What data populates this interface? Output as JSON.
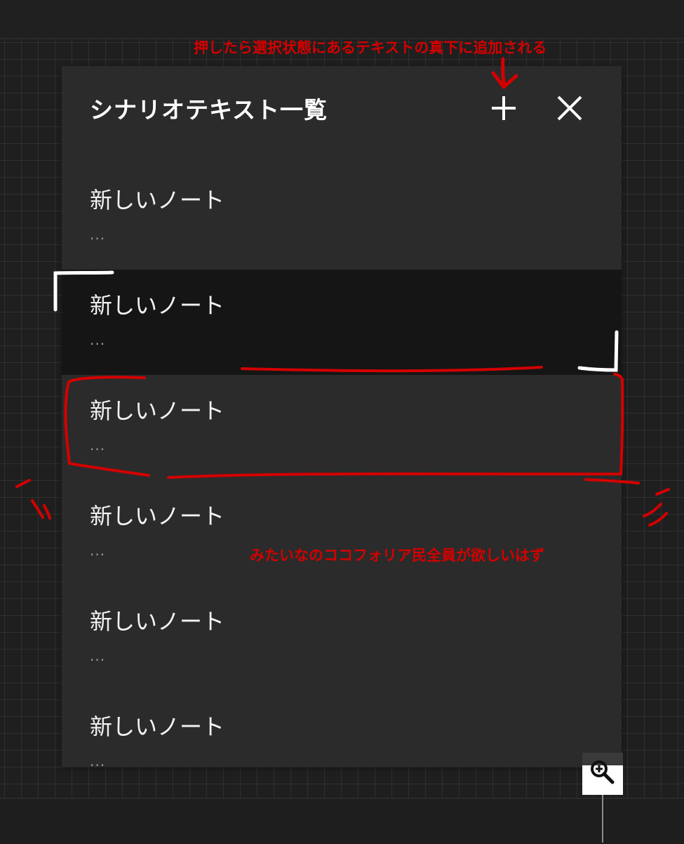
{
  "panel": {
    "title": "シナリオテキスト一覧",
    "add_icon": "plus-icon",
    "close_icon": "close-icon"
  },
  "notes": [
    {
      "title": "新しいノート",
      "preview": "...",
      "selected": false
    },
    {
      "title": "新しいノート",
      "preview": "...",
      "selected": true
    },
    {
      "title": "新しいノート",
      "preview": "...",
      "selected": false
    },
    {
      "title": "新しいノート",
      "preview": "...",
      "selected": false
    },
    {
      "title": "新しいノート",
      "preview": "...",
      "selected": false
    },
    {
      "title": "新しいノート",
      "preview": "...",
      "selected": false
    }
  ],
  "annotations": {
    "top_note": "押したら選択状態にあるテキストの真下に追加される",
    "middle_note": "みたいなのココフォリア民全員が欲しいはず"
  },
  "zoom": {
    "icon": "zoom-in-icon"
  },
  "colors": {
    "panel_bg": "#2b2b2b",
    "selected_bg": "#151515",
    "annotation_red": "#d40000"
  }
}
